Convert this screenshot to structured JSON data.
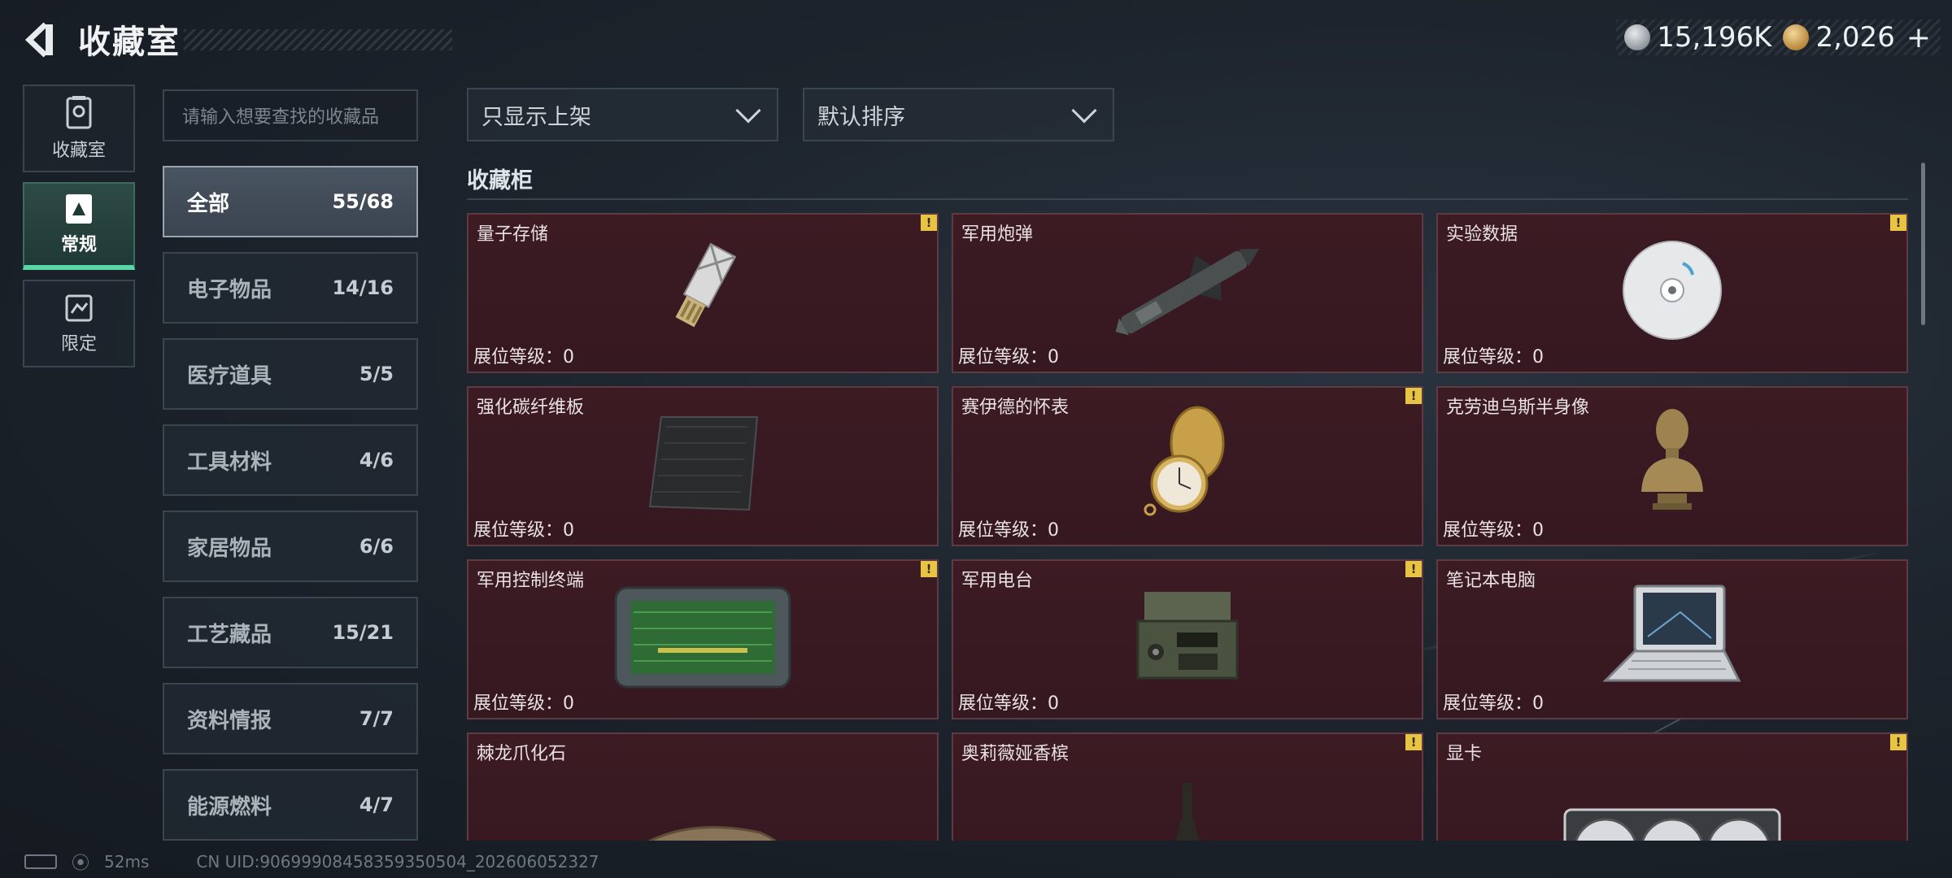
{
  "header": {
    "title": "收藏室",
    "currencies": [
      {
        "icon": "silver-coin-icon",
        "value": "15,196K"
      },
      {
        "icon": "gold-coin-icon",
        "value": "2,026"
      }
    ],
    "plus_label": "+"
  },
  "mode_nav": [
    {
      "label": "收藏室",
      "icon": "collection-room-icon",
      "active": false
    },
    {
      "label": "常规",
      "icon": "regular-icon",
      "active": true
    },
    {
      "label": "限定",
      "icon": "limited-icon",
      "active": false
    }
  ],
  "search": {
    "placeholder": "请输入想要查找的收藏品"
  },
  "categories": [
    {
      "name": "全部",
      "count": "55/68",
      "active": true
    },
    {
      "name": "电子物品",
      "count": "14/16"
    },
    {
      "name": "医疗道具",
      "count": "5/5"
    },
    {
      "name": "工具材料",
      "count": "4/6"
    },
    {
      "name": "家居物品",
      "count": "6/6"
    },
    {
      "name": "工艺藏品",
      "count": "15/21"
    },
    {
      "name": "资料情报",
      "count": "7/7"
    },
    {
      "name": "能源燃料",
      "count": "4/7"
    }
  ],
  "filters": {
    "display": "只显示上架",
    "sort": "默认排序"
  },
  "section_title": "收藏柜",
  "level_label": "展位等级：0",
  "items": [
    {
      "name": "量子存储",
      "badge": "!",
      "art": "usb-drive-icon"
    },
    {
      "name": "军用炮弹",
      "badge": "",
      "art": "missile-icon"
    },
    {
      "name": "实验数据",
      "badge": "!",
      "art": "disc-icon"
    },
    {
      "name": "强化碳纤维板",
      "badge": "",
      "art": "carbon-plate-icon"
    },
    {
      "name": "赛伊德的怀表",
      "badge": "!",
      "art": "pocket-watch-icon"
    },
    {
      "name": "克劳迪乌斯半身像",
      "badge": "",
      "art": "bust-icon"
    },
    {
      "name": "军用控制终端",
      "badge": "!",
      "art": "control-terminal-icon"
    },
    {
      "name": "军用电台",
      "badge": "!",
      "art": "radio-icon"
    },
    {
      "name": "笔记本电脑",
      "badge": "",
      "art": "laptop-icon"
    },
    {
      "name": "棘龙爪化石",
      "badge": "",
      "art": "claw-fossil-icon"
    },
    {
      "name": "奥莉薇娅香槟",
      "badge": "!",
      "art": "champagne-icon"
    },
    {
      "name": "显卡",
      "badge": "!",
      "art": "graphics-card-icon"
    }
  ],
  "footer": {
    "ping": "52ms",
    "uid": "CN UID:906999084583593505​04_202606052327"
  }
}
